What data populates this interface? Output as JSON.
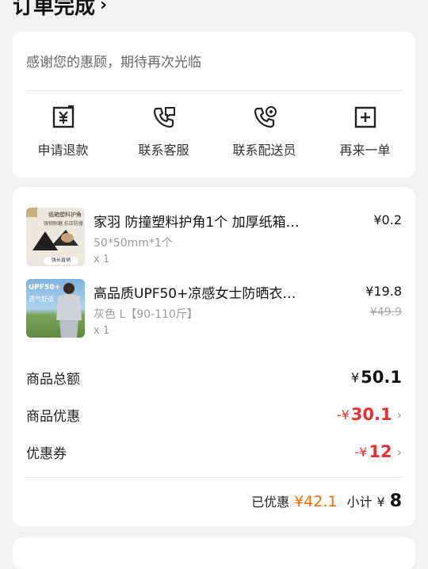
{
  "header": {
    "title": "订单完成"
  },
  "thanks": "感谢您的惠顾，期待再次光临",
  "actions": [
    {
      "label": "申请退款",
      "icon": "refund-icon"
    },
    {
      "label": "联系客服",
      "icon": "phone-service-icon"
    },
    {
      "label": "联系配送员",
      "icon": "phone-courier-icon"
    },
    {
      "label": "再来一单",
      "icon": "reorder-icon"
    }
  ],
  "items": [
    {
      "name": "家羽 防撞塑料护角1个 加厚纸箱…",
      "spec": "50*50mm*1个",
      "qty": "x 1",
      "price": "¥0.2",
      "thumb_text": [
        "纸箱塑料护角",
        "强韧耐磨 抗压防撞",
        "强长直销"
      ]
    },
    {
      "name": "高品质UPF50+凉感女士防晒衣…",
      "spec": "灰色 L【90-110斤】",
      "qty": "x 1",
      "price": "¥19.8",
      "orig_price": "¥49.9",
      "thumb_text": [
        "UPF50+",
        "透气舒适"
      ]
    }
  ],
  "totals": {
    "goods_total_label": "商品总额",
    "goods_total_currency": "¥",
    "goods_total_value": "50.1",
    "goods_discount_label": "商品优惠",
    "goods_discount_currency": "-¥",
    "goods_discount_value": "30.1",
    "coupon_label": "优惠券",
    "coupon_currency": "-¥",
    "coupon_value": "12"
  },
  "summary": {
    "saved_label": "已优惠",
    "saved_value": "¥42.1",
    "subtotal_label": "小计",
    "subtotal_currency": "¥",
    "subtotal_value": "8"
  },
  "colors": {
    "accent_red": "#e23232",
    "accent_orange": "#ff6a00"
  }
}
